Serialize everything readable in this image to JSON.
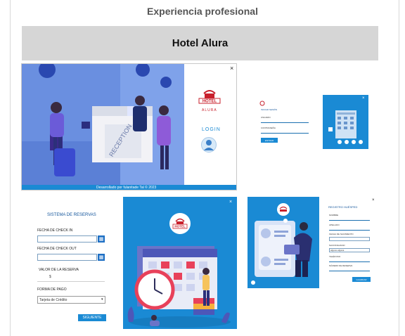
{
  "page": {
    "section_title": "Experiencia profesional",
    "banner_title": "Hotel Alura"
  },
  "login_screen": {
    "logo_text": "HOTEL",
    "logo_subtext": "ALURA",
    "login_label": "LOGIN",
    "footer_text": "Desarrollado por fulanitade Tal © 2023",
    "close_glyph": "×",
    "reception_sign": "RECEPTION"
  },
  "login_form_small": {
    "title": "INICIAR SESIÓN",
    "user_label": "USUARIO",
    "password_label": "CONTRASEÑA",
    "button_label": "ENTRAR"
  },
  "reservation_form": {
    "title": "SISTEMA DE RESERVAS",
    "checkin_label": "FECHA DE CHECK IN",
    "checkout_label": "FECHA DE CHECK OUT",
    "value_label": "VALOR DE LA RESERVA",
    "value_symbol": "$",
    "payment_label": "FORMA DE PAGO",
    "payment_selected": "Tarjeta de Crédito",
    "next_button": "SIGUIENTE"
  },
  "calendar_screen": {
    "logo_text": "HOTEL",
    "close_glyph": "×"
  },
  "register_screen": {
    "title": "REGISTRO HUÉSPED",
    "fields": [
      "NOMBRE",
      "APELLIDO",
      "FECHA DE NACIMIENTO",
      "NACIONALIDAD",
      "TELÉFONO",
      "NÚMERO DE RESERVA"
    ],
    "nationality_value": "afgano-afgana",
    "save_button": "GUARDAR",
    "close_glyph": "×"
  },
  "colors": {
    "primary_blue": "#1a8ad4",
    "dark_blue": "#12549a",
    "banner_gray": "#d6d6d6",
    "logo_red": "#c8202c"
  }
}
